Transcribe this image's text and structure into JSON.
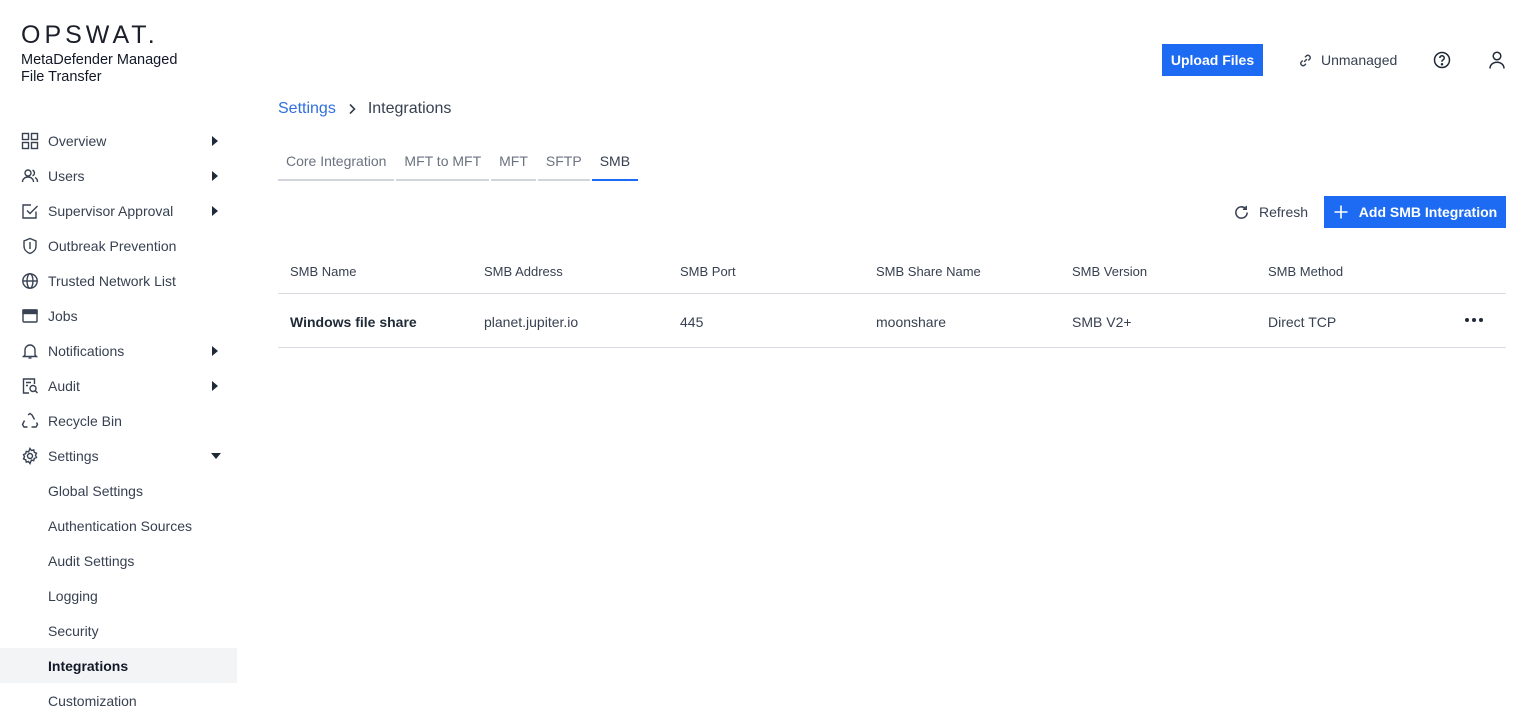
{
  "brand": {
    "logo": "OPSWAT.",
    "product_line1": "MetaDefender Managed",
    "product_line2": "File Transfer"
  },
  "sidebar": {
    "items": [
      {
        "label": "Overview",
        "icon": "grid-icon",
        "has_submenu": true
      },
      {
        "label": "Users",
        "icon": "users-icon",
        "has_submenu": true
      },
      {
        "label": "Supervisor Approval",
        "icon": "approval-icon",
        "has_submenu": true
      },
      {
        "label": "Outbreak Prevention",
        "icon": "shield-icon",
        "has_submenu": false
      },
      {
        "label": "Trusted Network List",
        "icon": "globe-icon",
        "has_submenu": false
      },
      {
        "label": "Jobs",
        "icon": "jobs-icon",
        "has_submenu": false
      },
      {
        "label": "Notifications",
        "icon": "bell-icon",
        "has_submenu": true
      },
      {
        "label": "Audit",
        "icon": "audit-icon",
        "has_submenu": true
      },
      {
        "label": "Recycle Bin",
        "icon": "recycle-icon",
        "has_submenu": false
      },
      {
        "label": "Settings",
        "icon": "gear-icon",
        "has_submenu": true,
        "expanded": true
      }
    ],
    "settings_sub": [
      {
        "label": "Global Settings"
      },
      {
        "label": "Authentication Sources"
      },
      {
        "label": "Audit Settings"
      },
      {
        "label": "Logging"
      },
      {
        "label": "Security"
      },
      {
        "label": "Integrations",
        "active": true
      },
      {
        "label": "Customization"
      }
    ]
  },
  "header": {
    "upload_label": "Upload Files",
    "unmanaged_label": "Unmanaged"
  },
  "breadcrumb": {
    "parent": "Settings",
    "current": "Integrations"
  },
  "tabs": [
    {
      "label": "Core Integration"
    },
    {
      "label": "MFT to MFT"
    },
    {
      "label": "MFT"
    },
    {
      "label": "SFTP"
    },
    {
      "label": "SMB",
      "active": true
    }
  ],
  "actions": {
    "refresh_label": "Refresh",
    "add_label": "Add SMB Integration"
  },
  "table": {
    "columns": [
      "SMB Name",
      "SMB Address",
      "SMB Port",
      "SMB Share Name",
      "SMB Version",
      "SMB Method"
    ],
    "rows": [
      [
        "Windows file share",
        "planet.jupiter.io",
        "445",
        "moonshare",
        "SMB V2+",
        "Direct TCP"
      ]
    ]
  },
  "colors": {
    "accent": "#1d6bf3",
    "link": "#2f6fe0",
    "active_bg": "#f3f4f6"
  }
}
